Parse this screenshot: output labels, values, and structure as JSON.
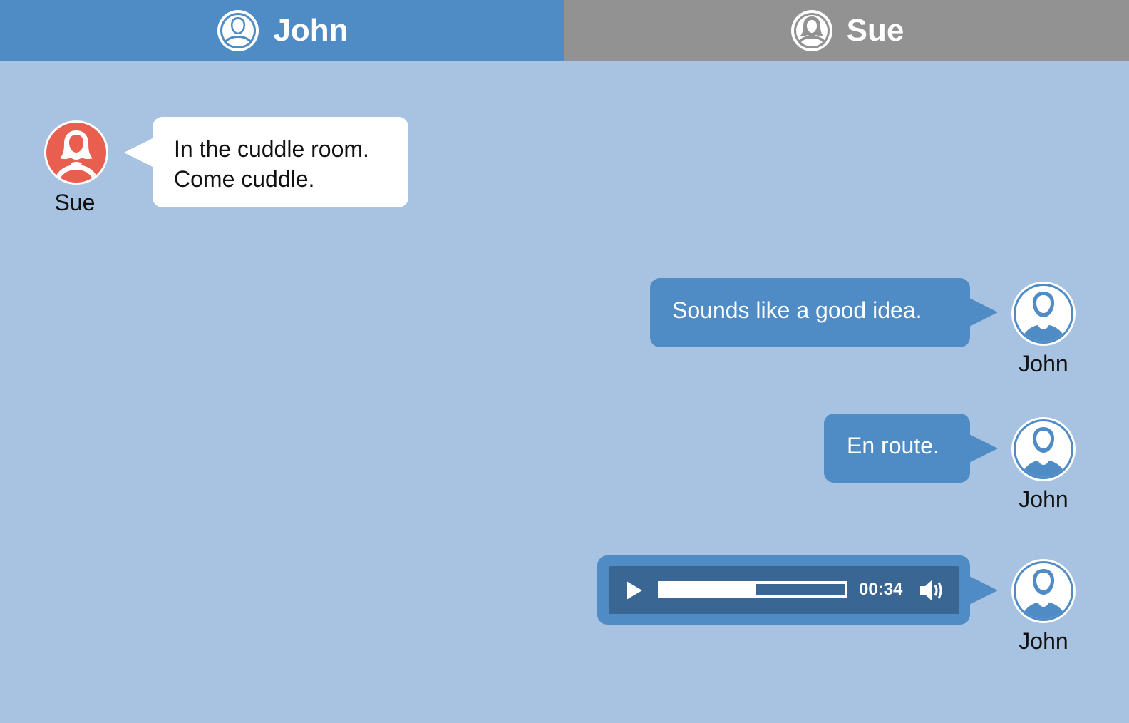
{
  "tabs": [
    {
      "label": "John",
      "icon": "user-male-icon",
      "active": true
    },
    {
      "label": "Sue",
      "icon": "user-female-icon",
      "active": false
    }
  ],
  "colors": {
    "background": "#a7c3e1",
    "tab_active": "#4f8bc5",
    "tab_inactive": "#929292",
    "bubble_outgoing": "#4f8bc5",
    "bubble_incoming": "#ffffff",
    "avatar_sue": "#e95f4f",
    "avatar_john": "#4f8bc5",
    "player_bg": "#3a6694"
  },
  "messages": [
    {
      "sender": "Sue",
      "lines": [
        "In the cuddle room.",
        "Come cuddle."
      ]
    },
    {
      "sender": "John",
      "text": "Sounds like a good idea."
    },
    {
      "sender": "John",
      "text": "En route."
    },
    {
      "sender": "John",
      "audio": {
        "time": "00:34",
        "progress": 0.52,
        "play_icon": "play-icon",
        "volume_icon": "volume-icon"
      }
    }
  ]
}
